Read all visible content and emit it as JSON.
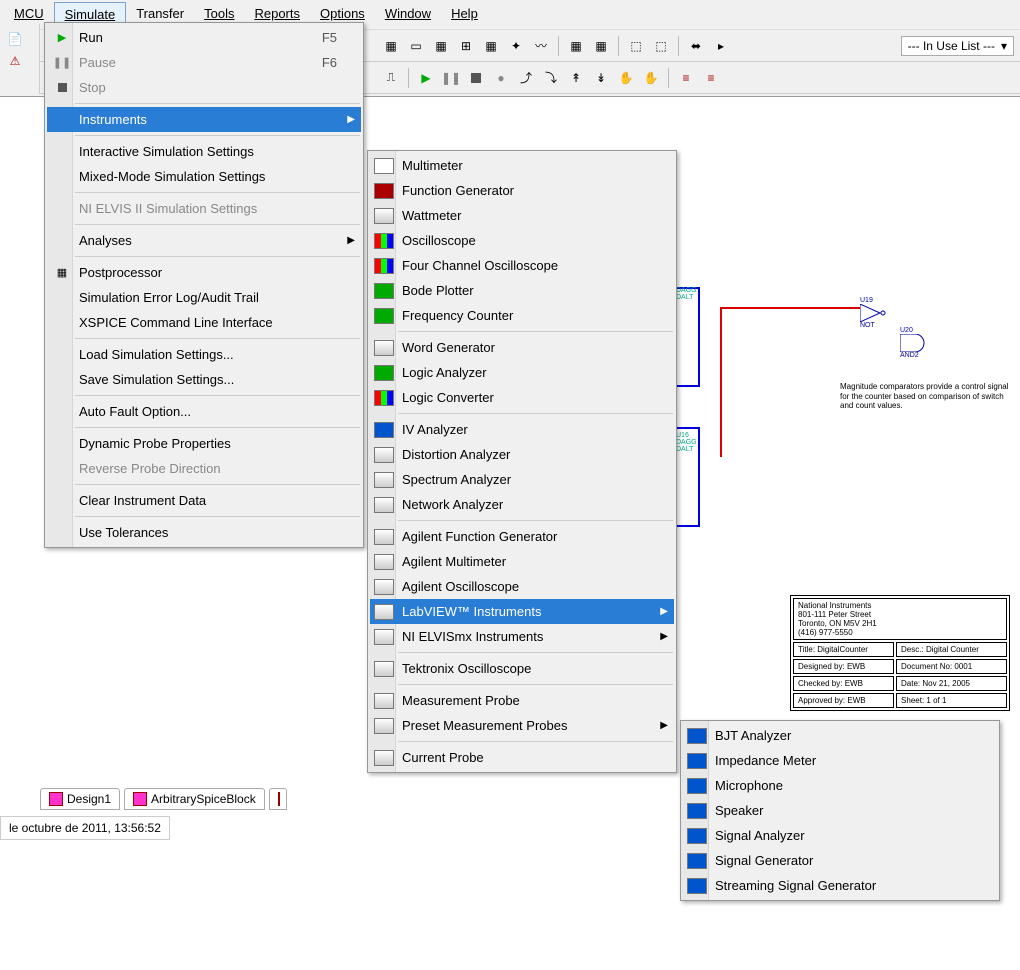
{
  "menubar": {
    "items": [
      {
        "label": "MCU",
        "mnemonic": "M"
      },
      {
        "label": "Simulate",
        "mnemonic": "S"
      },
      {
        "label": "Transfer",
        "mnemonic": ""
      },
      {
        "label": "Tools",
        "mnemonic": "T"
      },
      {
        "label": "Reports",
        "mnemonic": "R"
      },
      {
        "label": "Options",
        "mnemonic": "O"
      },
      {
        "label": "Window",
        "mnemonic": "W"
      },
      {
        "label": "Help",
        "mnemonic": "H"
      }
    ]
  },
  "toolbar_dropdown": "--- In Use List ---",
  "simulate_menu": {
    "items": [
      {
        "label": "Run",
        "shortcut": "F5",
        "icon": "play",
        "enabled": true
      },
      {
        "label": "Pause",
        "shortcut": "F6",
        "icon": "pause",
        "enabled": false
      },
      {
        "label": "Stop",
        "icon": "stop",
        "enabled": false
      },
      {
        "separator": true
      },
      {
        "label": "Instruments",
        "submenu": true,
        "highlighted": true
      },
      {
        "separator": true
      },
      {
        "label": "Interactive Simulation Settings"
      },
      {
        "label": "Mixed-Mode Simulation Settings"
      },
      {
        "separator": true
      },
      {
        "label": "NI ELVIS II Simulation Settings",
        "enabled": false
      },
      {
        "separator": true
      },
      {
        "label": "Analyses",
        "submenu": true
      },
      {
        "separator": true
      },
      {
        "label": "Postprocessor",
        "icon": "grid"
      },
      {
        "label": "Simulation Error Log/Audit Trail"
      },
      {
        "label": "XSPICE Command Line Interface"
      },
      {
        "separator": true
      },
      {
        "label": "Load Simulation Settings..."
      },
      {
        "label": "Save Simulation Settings..."
      },
      {
        "separator": true
      },
      {
        "label": "Auto Fault Option..."
      },
      {
        "separator": true
      },
      {
        "label": "Dynamic Probe Properties"
      },
      {
        "label": "Reverse Probe Direction",
        "enabled": false
      },
      {
        "separator": true
      },
      {
        "label": "Clear Instrument Data"
      },
      {
        "separator": true
      },
      {
        "label": "Use Tolerances"
      }
    ]
  },
  "instruments_menu": {
    "items": [
      {
        "label": "Multimeter"
      },
      {
        "label": "Function Generator"
      },
      {
        "label": "Wattmeter"
      },
      {
        "label": "Oscilloscope"
      },
      {
        "label": "Four Channel Oscilloscope"
      },
      {
        "label": "Bode Plotter"
      },
      {
        "label": "Frequency Counter"
      },
      {
        "separator": true
      },
      {
        "label": "Word Generator"
      },
      {
        "label": "Logic Analyzer"
      },
      {
        "label": "Logic Converter"
      },
      {
        "separator": true
      },
      {
        "label": "IV Analyzer"
      },
      {
        "label": "Distortion Analyzer"
      },
      {
        "label": "Spectrum Analyzer"
      },
      {
        "label": "Network Analyzer"
      },
      {
        "separator": true
      },
      {
        "label": "Agilent Function Generator"
      },
      {
        "label": "Agilent Multimeter"
      },
      {
        "label": "Agilent Oscilloscope"
      },
      {
        "label": "LabVIEW™ Instruments",
        "submenu": true,
        "highlighted": true
      },
      {
        "label": "NI ELVISmx Instruments",
        "submenu": true
      },
      {
        "separator": true
      },
      {
        "label": "Tektronix Oscilloscope"
      },
      {
        "separator": true
      },
      {
        "label": "Measurement Probe"
      },
      {
        "label": "Preset Measurement Probes",
        "submenu": true
      },
      {
        "separator": true
      },
      {
        "label": "Current Probe"
      }
    ]
  },
  "labview_menu": {
    "items": [
      {
        "label": "BJT Analyzer"
      },
      {
        "label": "Impedance Meter"
      },
      {
        "label": "Microphone"
      },
      {
        "label": "Speaker"
      },
      {
        "label": "Signal Analyzer"
      },
      {
        "label": "Signal Generator"
      },
      {
        "label": "Streaming Signal Generator"
      }
    ]
  },
  "tabs": [
    {
      "label": "Design1"
    },
    {
      "label": "ArbitrarySpiceBlock"
    }
  ],
  "status_text": "le octubre de 2011, 13:56:52",
  "schematic_note": "Magnitude comparators provide a control signal for the counter based on comparison of switch and count values.",
  "schematic_labels": {
    "u19": "U19",
    "not": "NOT",
    "u20": "U20",
    "and2": "AND2",
    "u16": "U16",
    "dagg": "DAGG",
    "dalt": "DALT"
  },
  "titleblock": {
    "company": "National Instruments",
    "addr1": "801-111 Peter Street",
    "addr2": "Toronto, ON M5V 2H1",
    "phone": "(416) 977-5550",
    "title_lbl": "Title:",
    "title_val": "DigitalCounter",
    "desc_lbl": "Desc.:",
    "desc_val": "Digital Counter",
    "designed_lbl": "Designed by:",
    "designed_val": "EWB",
    "docno_lbl": "Document No:",
    "docno_val": "0001",
    "checked_lbl": "Checked by:",
    "checked_val": "EWB",
    "date_lbl": "Date:",
    "date_val": "Nov 21, 2005",
    "approved_lbl": "Approved by:",
    "approved_val": "EWB",
    "sheet_lbl": "Sheet:",
    "sheet_val": "1   of   1"
  }
}
